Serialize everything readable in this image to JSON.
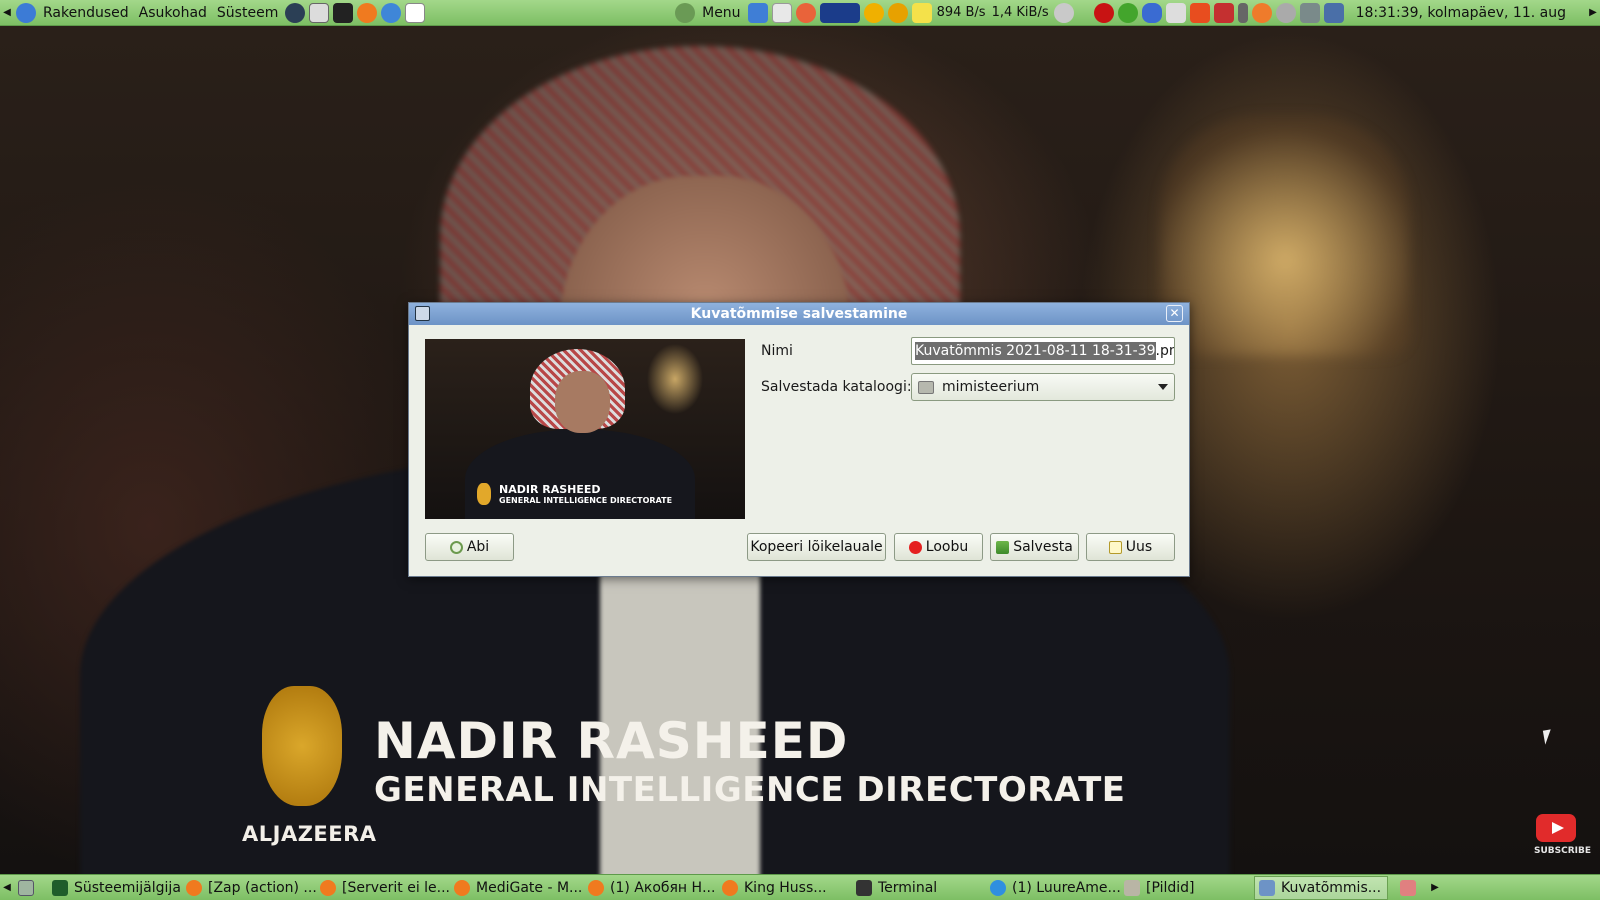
{
  "top_panel": {
    "menus": [
      "Rakendused",
      "Asukohad",
      "Süsteem"
    ],
    "menu_label": "Menu",
    "net_down": "894 B/s",
    "net_up": "1,4 KiB/s",
    "clock": "18:31:39, kolmapäev, 11. aug"
  },
  "background": {
    "caption_name": "NADIR RASHEED",
    "caption_title": "GENERAL INTELLIGENCE DIRECTORATE",
    "channel_logo_text": "ALJAZEERA",
    "subscribe_label": "SUBSCRIBE"
  },
  "dialog": {
    "title": "Kuvatõmmise salvestamine",
    "preview": {
      "caption_name": "NADIR RASHEED",
      "caption_title": "GENERAL INTELLIGENCE DIRECTORATE"
    },
    "name_label": "Nimi",
    "name_value_selected": "Kuvatõmmis 2021-08-11 18-31-39",
    "name_value_ext": ".png",
    "folder_label": "Salvestada kataloogi:",
    "folder_value": "mimisteerium",
    "buttons": {
      "help": "Abi",
      "copy": "Kopeeri lõikelauale",
      "cancel": "Loobu",
      "save": "Salvesta",
      "new": "Uus"
    }
  },
  "taskbar": {
    "tasks": [
      {
        "label": "Süsteemijälgija",
        "icon": "system-monitor-icon"
      },
      {
        "label": "[Zap (action) ...",
        "icon": "firefox-icon"
      },
      {
        "label": "[Serverit ei le...",
        "icon": "firefox-icon"
      },
      {
        "label": "MediGate - M...",
        "icon": "firefox-icon"
      },
      {
        "label": "(1) Акобян Н...",
        "icon": "firefox-icon"
      },
      {
        "label": "King Huss...",
        "icon": "firefox-icon"
      },
      {
        "label": "Terminal",
        "icon": "terminal-icon"
      },
      {
        "label": "(1) LuureAme...",
        "icon": "browser-icon"
      },
      {
        "label": "[Pildid]",
        "icon": "folder-icon"
      },
      {
        "label": "Kuvatõmmis...",
        "icon": "screenshot-icon"
      }
    ]
  },
  "colors": {
    "panel_green": "#8cca72",
    "dialog_title_blue": "#7aa0d2",
    "dialog_bg": "#edf0e8",
    "cancel_red": "#e52020"
  }
}
